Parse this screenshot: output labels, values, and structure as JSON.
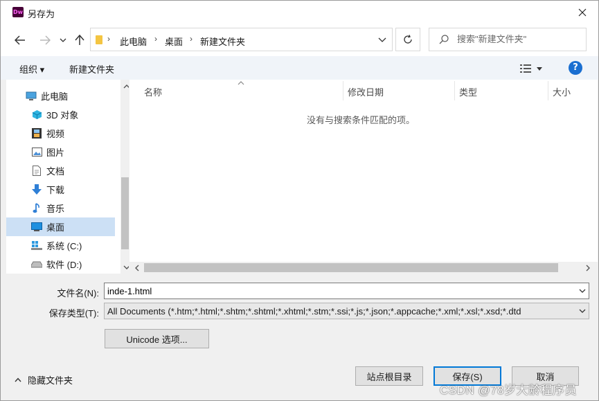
{
  "window": {
    "app_icon": "Dw",
    "title": "另存为",
    "close_icon": "close-icon"
  },
  "navigation": {
    "breadcrumbs": [
      "此电脑",
      "桌面",
      "新建文件夹"
    ],
    "search_placeholder": "搜索\"新建文件夹\""
  },
  "toolbar": {
    "organize_label": "组织 ▾",
    "new_folder_label": "新建文件夹",
    "help_label": "?"
  },
  "sidebar": {
    "items": [
      {
        "label": "此电脑",
        "icon": "computer-icon"
      },
      {
        "label": "3D 对象",
        "icon": "cube-icon"
      },
      {
        "label": "视频",
        "icon": "film-icon"
      },
      {
        "label": "图片",
        "icon": "picture-icon"
      },
      {
        "label": "文档",
        "icon": "document-icon"
      },
      {
        "label": "下载",
        "icon": "download-arrow-icon"
      },
      {
        "label": "音乐",
        "icon": "music-note-icon"
      },
      {
        "label": "桌面",
        "icon": "desktop-icon",
        "selected": true
      },
      {
        "label": "系统 (C:)",
        "icon": "windows-drive-icon"
      },
      {
        "label": "软件 (D:)",
        "icon": "drive-icon"
      }
    ]
  },
  "file_list": {
    "columns": [
      "名称",
      "修改日期",
      "类型",
      "大小"
    ],
    "empty_message": "没有与搜索条件匹配的项。"
  },
  "form": {
    "filename_label": "文件名(N):",
    "filename_value": "inde-1.html",
    "filetype_label": "保存类型(T):",
    "filetype_value": "All Documents (*.htm;*.html;*.shtm;*.shtml;*.xhtml;*.stm;*.ssi;*.js;*.json;*.appcache;*.xml;*.xsl;*.xsd;*.dtd",
    "unicode_button": "Unicode 选项..."
  },
  "footer": {
    "hide_folders_label": "隐藏文件夹",
    "site_root_button": "站点根目录",
    "save_button": "保存(S)",
    "cancel_button": "取消",
    "watermark": "CSDN @78岁大龄程序员"
  },
  "colors": {
    "selection": "#cce0f5",
    "accent": "#0078d7",
    "toolbar_bg": "#f0f4f9",
    "help_blue": "#1a6fd1"
  }
}
